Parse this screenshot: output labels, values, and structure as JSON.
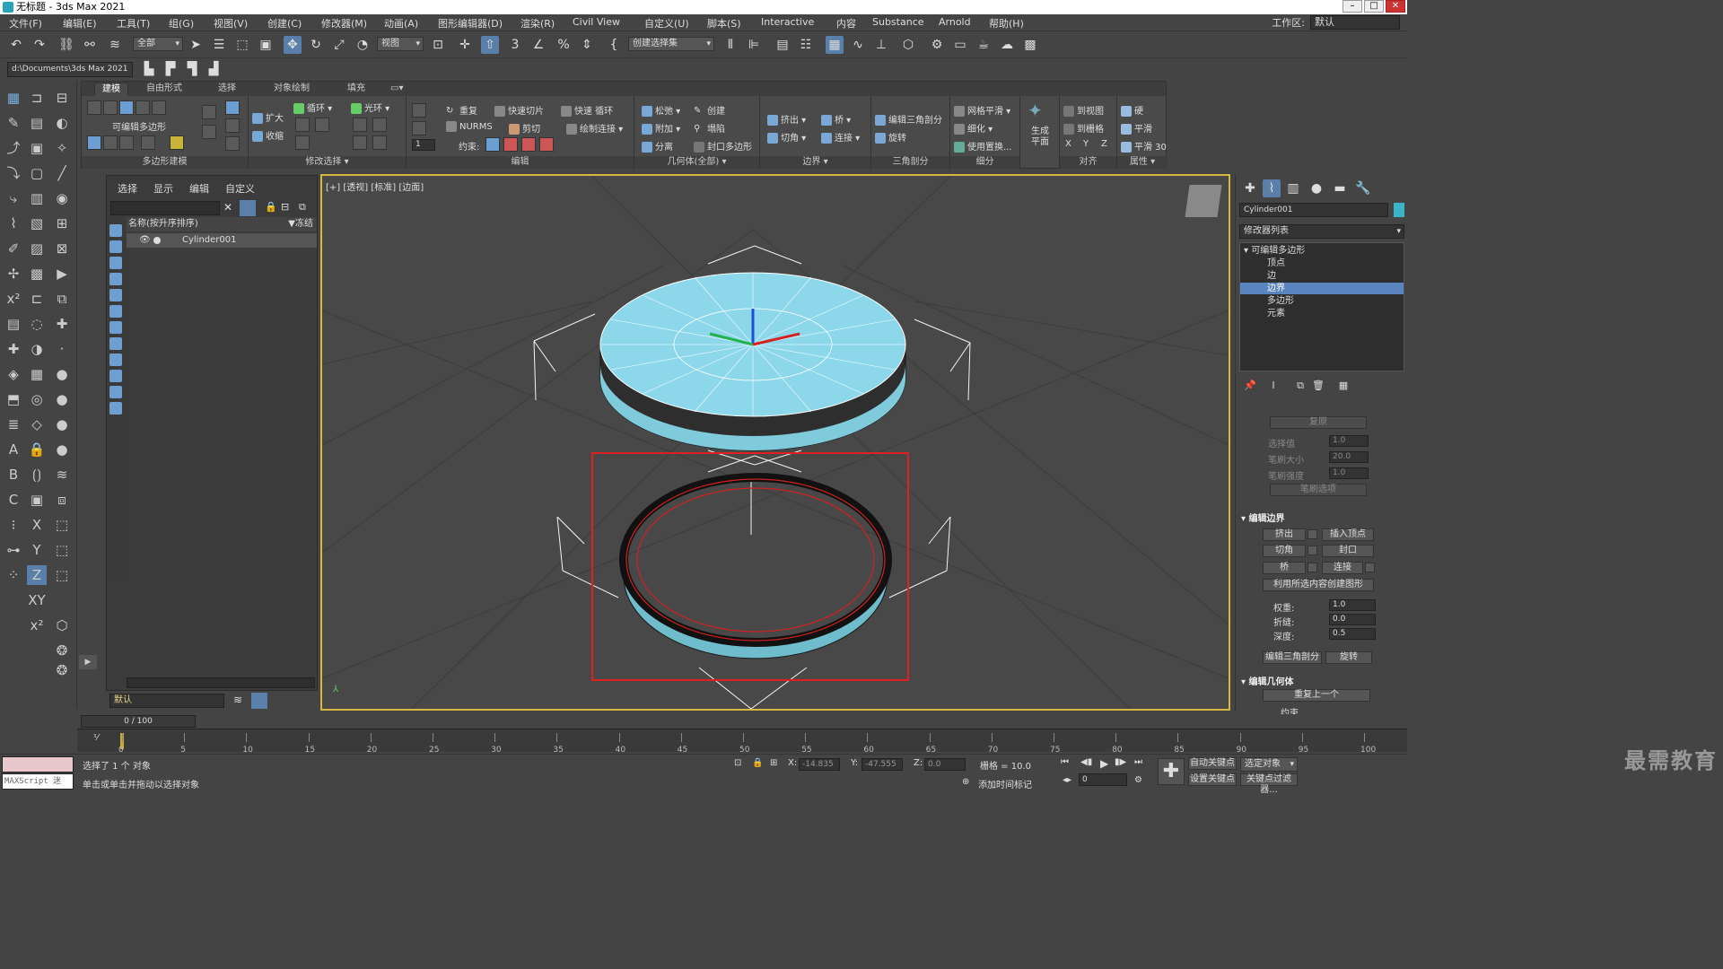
{
  "window": {
    "title": "无标题 - 3ds Max 2021"
  },
  "menu": [
    "文件(F)",
    "编辑(E)",
    "工具(T)",
    "组(G)",
    "视图(V)",
    "创建(C)",
    "修改器(M)",
    "动画(A)",
    "图形编辑器(D)",
    "渲染(R)",
    "Civil View",
    "自定义(U)",
    "脚本(S)",
    "Interactive",
    "内容",
    "Substance",
    "Arnold",
    "帮助(H)"
  ],
  "workspace": {
    "label": "工作区:",
    "value": "默认"
  },
  "toolbar": {
    "selection_filter": "全部",
    "ref_coord": "视图",
    "named_selection": "创建选择集",
    "project_path": "d:\\Documents\\3ds Max 2021"
  },
  "ribbon": {
    "tabs": [
      "建模",
      "自由形式",
      "选择",
      "对象绘制",
      "填充"
    ],
    "groups": {
      "poly_modeling": "多边形建模",
      "editable_poly": "可编辑多边形",
      "modify_selection": "修改选择",
      "edit": "编辑",
      "geometry": "几何体(全部)",
      "border": "边界",
      "triangulation": "三角剖分",
      "subdivision": "细分",
      "align": "对齐",
      "properties": "属性"
    },
    "buttons": {
      "grow": "扩大",
      "shrink": "收缩",
      "loop": "循环",
      "ring": "光环",
      "repeat": "重复",
      "quick_slice": "快速切片",
      "quick_loop": "快速 循环",
      "nurms": "NURMS",
      "cut": "剪切",
      "paint_connect": "绘制连接",
      "constrain": "约束:",
      "relax": "松弛",
      "create": "创建",
      "attach": "附加",
      "collapse": "塌陷",
      "detach": "分离",
      "cap_poly": "封口多边形",
      "extrude": "挤出",
      "bridge": "桥",
      "chamfer": "切角",
      "connect": "连接",
      "edit_tri": "编辑三角剖分",
      "turn": "旋转",
      "meshsmooth": "网格平滑",
      "tessellate": "细化",
      "use_displace": "使用置换...",
      "generate_plane": "生成平面",
      "to_view": "到视图",
      "to_grid": "到栅格",
      "hard": "硬",
      "smooth": "平滑",
      "smooth30": "平滑 30",
      "x": "X",
      "y": "Y",
      "z": "Z"
    }
  },
  "scene_explorer": {
    "tabs": [
      "选择",
      "显示",
      "编辑",
      "自定义"
    ],
    "column": "名称(按升序排序)",
    "freeze": "▼冻结",
    "object": "Cylinder001",
    "layer": "默认"
  },
  "viewport": {
    "label": "[+] [透视] [标准] [边面]"
  },
  "command_panel": {
    "object_name": "Cylinder001",
    "object_color": "#3bb4c8",
    "modifier_list": "修改器列表",
    "stack": [
      "可编辑多边形",
      "顶点",
      "边",
      "边界",
      "多边形",
      "元素"
    ],
    "stack_selected_index": 3,
    "soft_sel": {
      "restore": "复原",
      "select_value_label": "选择值",
      "select_value": "1.0",
      "brush_size_label": "笔刷大小",
      "brush_size": "20.0",
      "brush_strength_label": "笔刷强度",
      "brush_strength": "1.0",
      "brush_options": "笔刷选项"
    },
    "edit_borders": {
      "title": "编辑边界",
      "extrude": "挤出",
      "insert_vertex": "插入顶点",
      "chamfer": "切角",
      "cap": "封口",
      "bridge": "桥",
      "connect": "连接",
      "create_shape": "利用所选内容创建图形",
      "weight_label": "权重:",
      "weight": "1.0",
      "crease_label": "折缝:",
      "crease": "0.0",
      "depth_label": "深度:",
      "depth": "0.5",
      "edit_tri": "编辑三角剖分",
      "turn": "旋转"
    },
    "edit_geometry": {
      "title": "编辑几何体",
      "repeat_last": "重复上一个",
      "constraints": "约束"
    }
  },
  "timeline": {
    "frame": "0 / 100",
    "ticks": [
      "0",
      "5",
      "10",
      "15",
      "20",
      "25",
      "30",
      "35",
      "40",
      "45",
      "50",
      "55",
      "60",
      "65",
      "70",
      "75",
      "80",
      "85",
      "90",
      "95",
      "100"
    ]
  },
  "status": {
    "selected": "选择了 1 个 对象",
    "hint": "单击或单击并拖动以选择对象",
    "maxscript": "MAXScript 迷",
    "x_label": "X:",
    "x": "-14.835",
    "y_label": "Y:",
    "y": "-47.555",
    "z_label": "Z:",
    "z": "0.0",
    "grid": "栅格 = 10.0",
    "add_time_tag": "添加时间标记",
    "auto_key": "自动关键点",
    "set_key": "设置关键点",
    "selected_obj": "选定对象",
    "key_filters": "关键点过滤器...",
    "frame_field": "0"
  },
  "watermark": "最需教育"
}
